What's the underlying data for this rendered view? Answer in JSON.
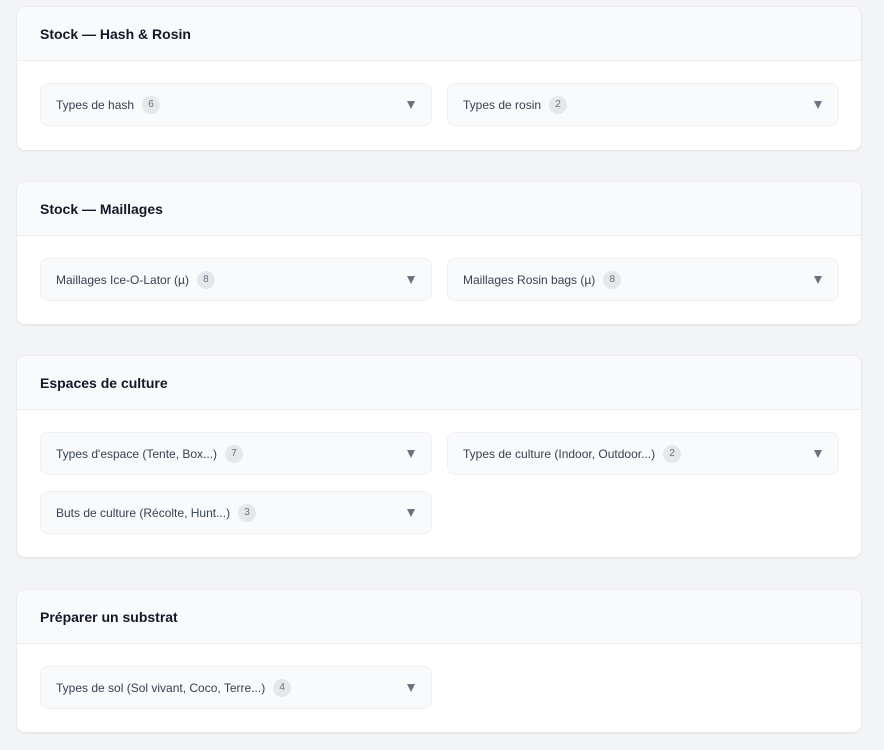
{
  "sections": [
    {
      "title": "Stock — Hash & Rosin",
      "items": [
        {
          "label": "Types de hash",
          "count": "6"
        },
        {
          "label": "Types de rosin",
          "count": "2"
        }
      ]
    },
    {
      "title": "Stock — Maillages",
      "items": [
        {
          "label": "Maillages Ice-O-Lator (µ)",
          "count": "8"
        },
        {
          "label": "Maillages Rosin bags (µ)",
          "count": "8"
        }
      ]
    },
    {
      "title": "Espaces de culture",
      "items": [
        {
          "label": "Types d'espace (Tente, Box...)",
          "count": "7"
        },
        {
          "label": "Types de culture (Indoor, Outdoor...)",
          "count": "2"
        },
        {
          "label": "Buts de culture (Récolte, Hunt...)",
          "count": "3"
        }
      ]
    },
    {
      "title": "Préparer un substrat",
      "items": [
        {
          "label": "Types de sol (Sol vivant, Coco, Terre...)",
          "count": "4"
        }
      ]
    }
  ],
  "icons": {
    "expand": "chevron-down-icon"
  }
}
